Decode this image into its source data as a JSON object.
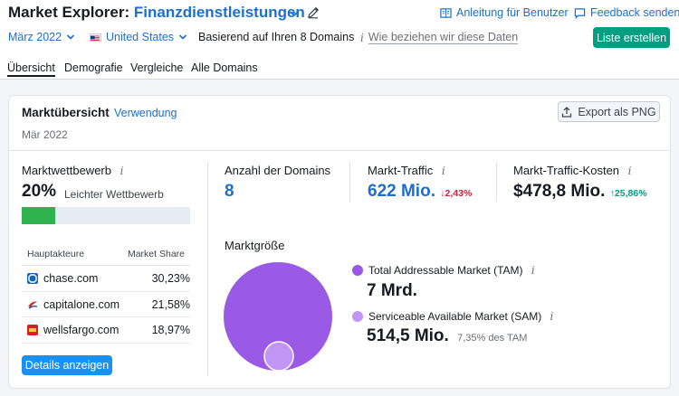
{
  "header": {
    "app_title": "Market Explorer:",
    "niche": "Finanzdienstleistungen",
    "links": {
      "guide": "Anleitung für Benutzer",
      "feedback": "Feedback senden"
    }
  },
  "filters": {
    "date": "März 2022",
    "country": "United States",
    "based_on": "Basierend auf Ihren 8 Domains",
    "data_source_link": "Wie beziehen wir diese Daten",
    "create_list_button": "Liste erstellen"
  },
  "tabs": [
    "Übersicht",
    "Demografie",
    "Vergleiche",
    "Alle Domains"
  ],
  "card": {
    "title": "Marktübersicht",
    "usage_link": "Verwendung",
    "export_button": "Export als PNG",
    "date": "Mär 2022",
    "competition": {
      "label": "Marktwettbewerb",
      "value": "20%",
      "description": "Leichter Wettbewerb",
      "fill_fraction": 0.2,
      "fill_color": "#2fb34e"
    },
    "players": {
      "col_domain": "Hauptakteure",
      "col_share": "Market Share",
      "rows": [
        {
          "domain": "chase.com",
          "share": "30,23%",
          "icon": "chase-logo-icon",
          "color": "#1763b8"
        },
        {
          "domain": "capitalone.com",
          "share": "21,58%",
          "icon": "capitalone-logo-icon",
          "color": "#d03027"
        },
        {
          "domain": "wellsfargo.com",
          "share": "18,97%",
          "icon": "wellsfargo-logo-icon",
          "color": "#d71e28"
        }
      ]
    },
    "details_button": "Details anzeigen",
    "kpis": {
      "domains": {
        "label": "Anzahl der Domains",
        "value": "8"
      },
      "traffic": {
        "label": "Markt-Traffic",
        "value": "622 Mio.",
        "delta": "↓2,43%"
      },
      "cost": {
        "label": "Markt-Traffic-Kosten",
        "value": "$478,8 Mio.",
        "delta": "↑25,86%"
      }
    },
    "market_size": {
      "title": "Marktgröße",
      "tam": {
        "label": "Total Addressable Market (TAM)",
        "value": "7 Mrd.",
        "color": "#9a5ae6"
      },
      "sam": {
        "label": "Serviceable Available Market (SAM)",
        "value": "514,5 Mio.",
        "share": "7,35% des TAM",
        "color": "#c195f5"
      }
    },
    "info_glyph": "i"
  },
  "colors": {
    "accent": "#1c6fd1",
    "primary_green": "#009f81",
    "button_blue": "#1c90f0"
  }
}
